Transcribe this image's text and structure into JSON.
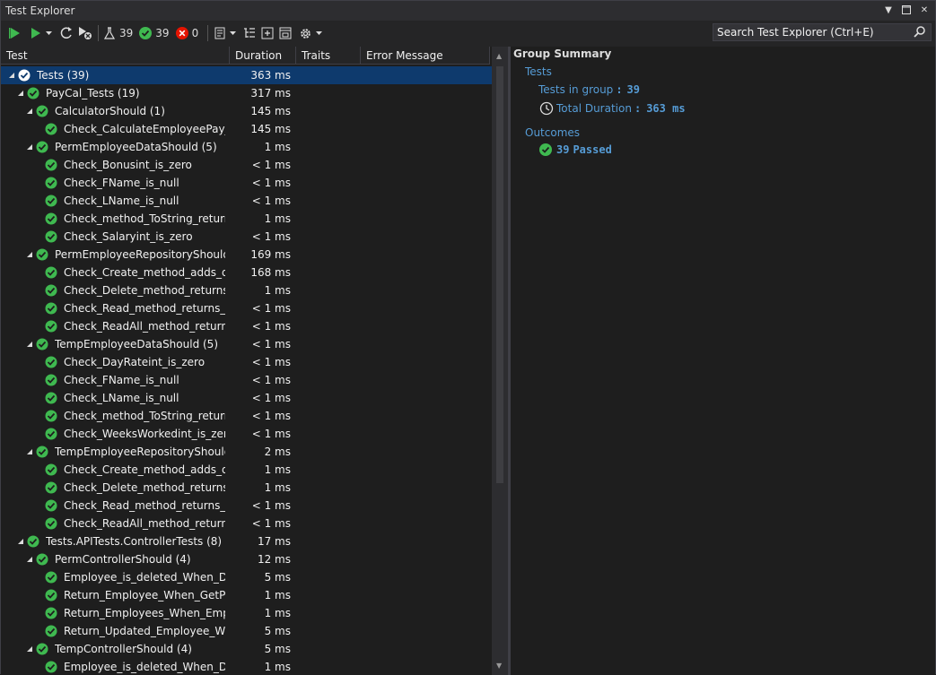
{
  "window": {
    "title": "Test Explorer"
  },
  "toolbar": {
    "total_count": "39",
    "passed_count": "39",
    "failed_count": "0"
  },
  "search": {
    "placeholder": "Search Test Explorer (Ctrl+E)"
  },
  "columns": {
    "test": "Test",
    "duration": "Duration",
    "traits": "Traits",
    "error": "Error Message"
  },
  "tree": [
    {
      "name": "Tests (39)",
      "duration": "363 ms",
      "level": 0,
      "expanded": true
    },
    {
      "name": "PayCal_Tests (19)",
      "duration": "317 ms",
      "level": 1,
      "expanded": true
    },
    {
      "name": "CalculatorShould (1)",
      "duration": "145 ms",
      "level": 2,
      "expanded": true
    },
    {
      "name": "Check_CalculateEmployeePay_...",
      "duration": "145 ms",
      "level": 3
    },
    {
      "name": "PermEmployeeDataShould (5)",
      "duration": "1 ms",
      "level": 2,
      "expanded": true
    },
    {
      "name": "Check_Bonusint_is_zero",
      "duration": "< 1 ms",
      "level": 3
    },
    {
      "name": "Check_FName_is_null",
      "duration": "< 1 ms",
      "level": 3
    },
    {
      "name": "Check_LName_is_null",
      "duration": "< 1 ms",
      "level": 3
    },
    {
      "name": "Check_method_ToString_return...",
      "duration": "1 ms",
      "level": 3
    },
    {
      "name": "Check_Salaryint_is_zero",
      "duration": "< 1 ms",
      "level": 3
    },
    {
      "name": "PermEmployeeRepositoryShould (...",
      "duration": "169 ms",
      "level": 2,
      "expanded": true
    },
    {
      "name": "Check_Create_method_adds_da...",
      "duration": "168 ms",
      "level": 3
    },
    {
      "name": "Check_Delete_method_returns_...",
      "duration": "1 ms",
      "level": 3
    },
    {
      "name": "Check_Read_method_returns_al...",
      "duration": "< 1 ms",
      "level": 3
    },
    {
      "name": "Check_ReadAll_method_returns...",
      "duration": "< 1 ms",
      "level": 3
    },
    {
      "name": "TempEmployeeDataShould (5)",
      "duration": "< 1 ms",
      "level": 2,
      "expanded": true
    },
    {
      "name": "Check_DayRateint_is_zero",
      "duration": "< 1 ms",
      "level": 3
    },
    {
      "name": "Check_FName_is_null",
      "duration": "< 1 ms",
      "level": 3
    },
    {
      "name": "Check_LName_is_null",
      "duration": "< 1 ms",
      "level": 3
    },
    {
      "name": "Check_method_ToString_return...",
      "duration": "< 1 ms",
      "level": 3
    },
    {
      "name": "Check_WeeksWorkedint_is_zero",
      "duration": "< 1 ms",
      "level": 3
    },
    {
      "name": "TempEmployeeRepositoryShould ...",
      "duration": "2 ms",
      "level": 2,
      "expanded": true
    },
    {
      "name": "Check_Create_method_adds_da...",
      "duration": "1 ms",
      "level": 3
    },
    {
      "name": "Check_Delete_method_returns_...",
      "duration": "1 ms",
      "level": 3
    },
    {
      "name": "Check_Read_method_returns_al...",
      "duration": "< 1 ms",
      "level": 3
    },
    {
      "name": "Check_ReadAll_method_returns...",
      "duration": "< 1 ms",
      "level": 3
    },
    {
      "name": "Tests.APITests.ControllerTests (8)",
      "duration": "17 ms",
      "level": 1,
      "expanded": true
    },
    {
      "name": "PermControllerShould (4)",
      "duration": "12 ms",
      "level": 2,
      "expanded": true
    },
    {
      "name": "Employee_is_deleted_When_De...",
      "duration": "5 ms",
      "level": 3
    },
    {
      "name": "Return_Employee_When_GetPer...",
      "duration": "1 ms",
      "level": 3
    },
    {
      "name": "Return_Employees_When_Empl...",
      "duration": "1 ms",
      "level": 3
    },
    {
      "name": "Return_Updated_Employee_Wh...",
      "duration": "5 ms",
      "level": 3
    },
    {
      "name": "TempControllerShould (4)",
      "duration": "5 ms",
      "level": 2,
      "expanded": true
    },
    {
      "name": "Employee_is_deleted_When_De...",
      "duration": "1 ms",
      "level": 3
    }
  ],
  "summary": {
    "title": "Group Summary",
    "group_name": "Tests",
    "tests_in_group_label": "Tests in group",
    "tests_in_group_value": "39",
    "total_duration_label": "Total Duration",
    "total_duration_value": "363 ms",
    "outcomes_label": "Outcomes",
    "passed_count": "39",
    "passed_label": "Passed"
  },
  "colors": {
    "pass": "#3fb950",
    "fail": "#e51400",
    "link": "#569cd6",
    "selection": "#0e3a6d"
  }
}
